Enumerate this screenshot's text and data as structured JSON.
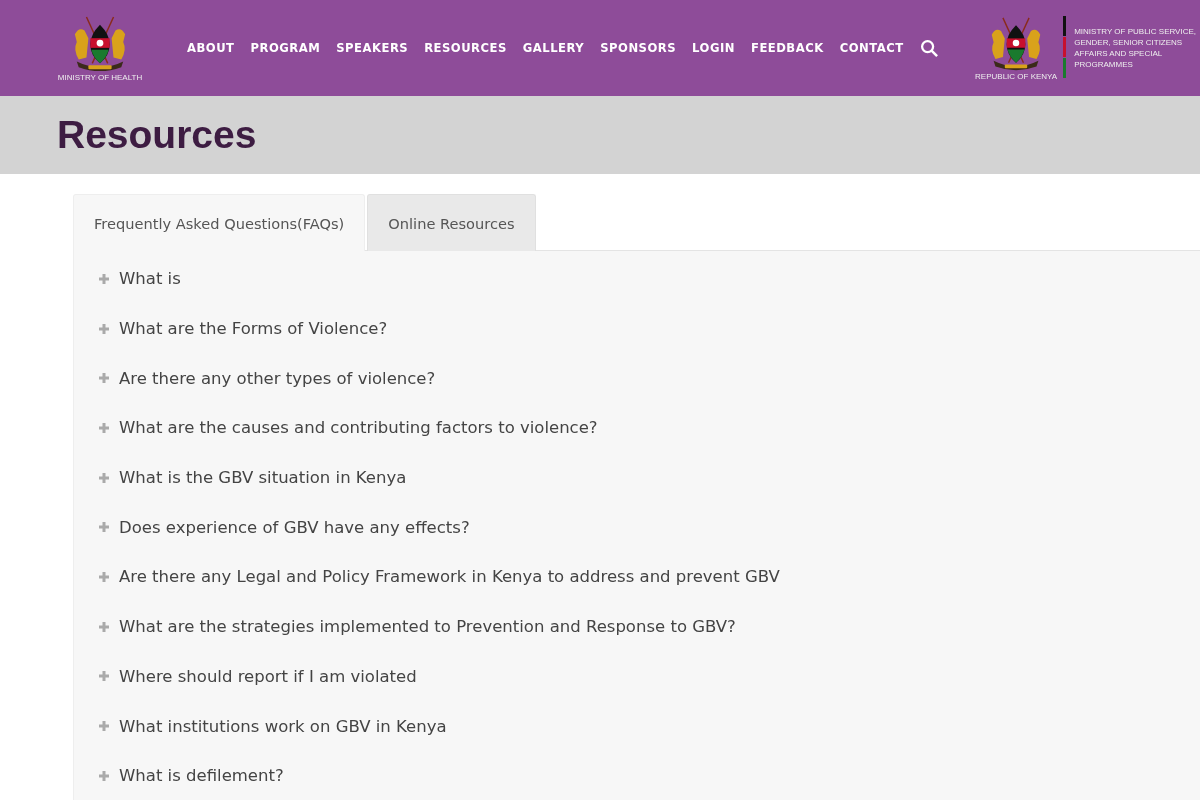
{
  "header": {
    "left_logo": {
      "caption": "MINISTRY OF HEALTH"
    },
    "nav": [
      {
        "label": "ABOUT"
      },
      {
        "label": "PROGRAM"
      },
      {
        "label": "SPEAKERS"
      },
      {
        "label": "RESOURCES"
      },
      {
        "label": "GALLERY"
      },
      {
        "label": "SPONSORS"
      },
      {
        "label": "LOGIN"
      },
      {
        "label": "FEEDBACK"
      },
      {
        "label": "CONTACT"
      }
    ],
    "right_logo": {
      "caption": "REPUBLIC OF KENYA",
      "ministry_lines": [
        "MINISTRY OF PUBLIC SERVICE,",
        "GENDER, SENIOR CITIZENS",
        "AFFAIRS AND SPECIAL",
        "PROGRAMMES"
      ]
    }
  },
  "page_title": "Resources",
  "tabs": [
    {
      "label": "Frequently Asked Questions(FAQs)",
      "selected": true
    },
    {
      "label": "Online Resources",
      "selected": false
    }
  ],
  "faqs": [
    {
      "question": "What is",
      "expanded": false
    },
    {
      "question": "What are the Forms of Violence?",
      "expanded": false
    },
    {
      "question": "Are there any other types of violence?",
      "expanded": false
    },
    {
      "question": "What are the causes and contributing factors to violence?",
      "expanded": false
    },
    {
      "question": "What is the GBV situation in Kenya",
      "expanded": false
    },
    {
      "question": "Does experience of GBV have any effects?",
      "expanded": false
    },
    {
      "question": "Are there any Legal and Policy Framework in Kenya to address and prevent GBV",
      "expanded": false
    },
    {
      "question": "What are the strategies implemented to Prevention and Response to GBV?",
      "expanded": false
    },
    {
      "question": "Where should report if I am violated",
      "expanded": false
    },
    {
      "question": "What institutions work on GBV in Kenya",
      "expanded": false
    },
    {
      "question": "What is defilement?",
      "expanded": false
    }
  ]
}
